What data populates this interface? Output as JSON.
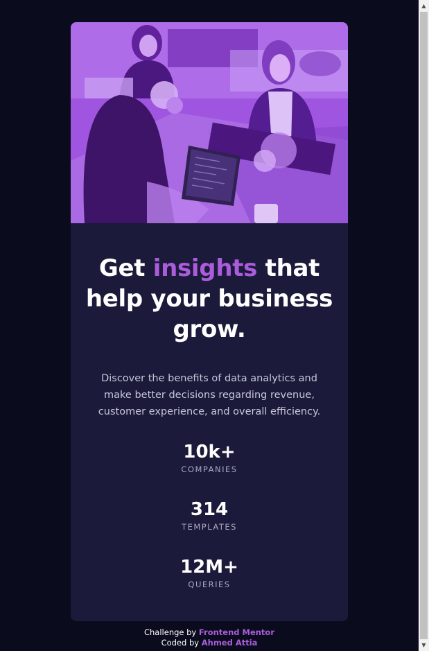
{
  "hero": {
    "alt": "people working at desks"
  },
  "heading": {
    "before": "Get ",
    "accent": "insights",
    "after": " that help your business grow."
  },
  "description": "Discover the benefits of data analytics and make better decisions regarding revenue, customer experience, and overall efficiency.",
  "stats": [
    {
      "value": "10k+",
      "label": "COMPANIES"
    },
    {
      "value": "314",
      "label": "TEMPLATES"
    },
    {
      "value": "12M+",
      "label": "QUERIES"
    }
  ],
  "attribution": {
    "line1_prefix": "Challenge by ",
    "line1_link": "Frontend Mentor",
    "line2_prefix": "Coded by ",
    "line2_link": "Ahmed Attia"
  },
  "colors": {
    "page_bg": "#0a0c1d",
    "card_bg": "#1b1a3a",
    "accent": "#aa5cdb",
    "image_overlay": "#8d3ce6"
  }
}
